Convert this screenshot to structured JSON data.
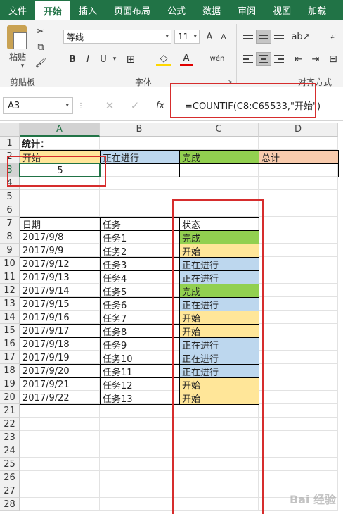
{
  "tabs": [
    {
      "label": "文件",
      "active": false
    },
    {
      "label": "开始",
      "active": true
    },
    {
      "label": "插入",
      "active": false
    },
    {
      "label": "页面布局",
      "active": false
    },
    {
      "label": "公式",
      "active": false
    },
    {
      "label": "数据",
      "active": false
    },
    {
      "label": "审阅",
      "active": false
    },
    {
      "label": "视图",
      "active": false
    },
    {
      "label": "加载",
      "active": false
    }
  ],
  "ribbon": {
    "paste_label": "粘贴",
    "clipboard_label": "剪贴板",
    "font_name": "等线",
    "font_size": "11",
    "font_group_label": "字体",
    "align_group_label": "对齐方式",
    "bold": "B",
    "italic": "I",
    "underline": "U",
    "font_color_letter": "A",
    "phonetic": "wén",
    "grow": "A",
    "shrink": "A"
  },
  "formula_bar": {
    "name_box": "A3",
    "fx_label": "fx",
    "formula": "=COUNTIF(C8:C65533,\"开始\")"
  },
  "columns": [
    "A",
    "B",
    "C",
    "D"
  ],
  "rows": [
    "1",
    "2",
    "3",
    "4",
    "5",
    "6",
    "7",
    "8",
    "9",
    "10",
    "11",
    "12",
    "13",
    "14",
    "15",
    "16",
    "17",
    "18",
    "19",
    "20",
    "21",
    "22",
    "23",
    "24",
    "25",
    "26",
    "27",
    "28"
  ],
  "summary": {
    "title": "统计：",
    "headers": [
      "开始",
      "正在进行",
      "完成",
      "总计"
    ],
    "count_value": "5"
  },
  "table": {
    "headers": [
      "日期",
      "任务",
      "状态"
    ],
    "rows": [
      {
        "date": "2017/9/8",
        "task": "任务1",
        "status": "完成"
      },
      {
        "date": "2017/9/9",
        "task": "任务2",
        "status": "开始"
      },
      {
        "date": "2017/9/12",
        "task": "任务3",
        "status": "正在进行"
      },
      {
        "date": "2017/9/13",
        "task": "任务4",
        "status": "正在进行"
      },
      {
        "date": "2017/9/14",
        "task": "任务5",
        "status": "完成"
      },
      {
        "date": "2017/9/15",
        "task": "任务6",
        "status": "正在进行"
      },
      {
        "date": "2017/9/16",
        "task": "任务7",
        "status": "开始"
      },
      {
        "date": "2017/9/17",
        "task": "任务8",
        "status": "开始"
      },
      {
        "date": "2017/9/18",
        "task": "任务9",
        "status": "正在进行"
      },
      {
        "date": "2017/9/19",
        "task": "任务10",
        "status": "正在进行"
      },
      {
        "date": "2017/9/20",
        "task": "任务11",
        "status": "正在进行"
      },
      {
        "date": "2017/9/21",
        "task": "任务12",
        "status": "开始"
      },
      {
        "date": "2017/9/22",
        "task": "任务13",
        "status": "开始"
      }
    ]
  },
  "status_colors": {
    "开始": "#ffe699",
    "正在进行": "#bdd7ee",
    "完成": "#92d050",
    "总计": "#f8cbad"
  },
  "accent_color": "#217346",
  "annotation_color": "#d62d2d",
  "watermark": "Bai 经验"
}
